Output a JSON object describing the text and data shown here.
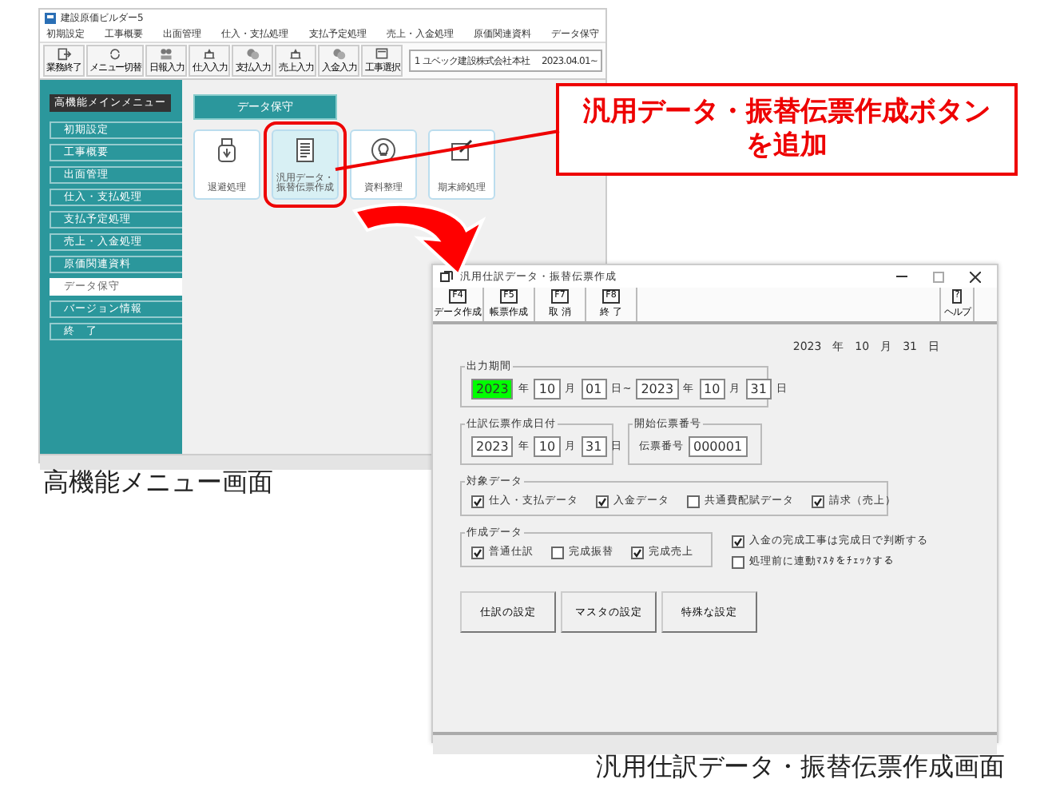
{
  "menu_window": {
    "title": "建設原価ビルダー5",
    "menu_bar": [
      "初期設定",
      "工事概要",
      "出面管理",
      "仕入・支払処理",
      "支払予定処理",
      "売上・入金処理",
      "原価関連資料",
      "データ保守"
    ],
    "toolbar": [
      "業務終了",
      "メニュー切替",
      "日報入力",
      "仕入入力",
      "支払入力",
      "売上入力",
      "入金入力",
      "工事選択"
    ],
    "company": "1 ユベック建設株式会社本社",
    "date": "2023.04.01~",
    "sidebar": {
      "header": "高機能メインメニュー",
      "items": [
        {
          "label": "初期設定",
          "selected": false
        },
        {
          "label": "工事概要",
          "selected": false
        },
        {
          "label": "出面管理",
          "selected": false
        },
        {
          "label": "仕入・支払処理",
          "selected": false
        },
        {
          "label": "支払予定処理",
          "selected": false
        },
        {
          "label": "売上・入金処理",
          "selected": false
        },
        {
          "label": "原価関連資料",
          "selected": false
        },
        {
          "label": "データ保守",
          "selected": true
        },
        {
          "label": "バージョン情報",
          "selected": false
        },
        {
          "label": "終　了",
          "selected": false
        }
      ]
    },
    "section_title": "データ保守",
    "tiles": [
      {
        "kind": "usb",
        "label": "退避処理",
        "highlighted": false
      },
      {
        "kind": "document",
        "label": "汎用データ・振替伝票作成",
        "highlighted": true
      },
      {
        "kind": "bulb",
        "label": "資料整理",
        "highlighted": false
      },
      {
        "kind": "edit",
        "label": "期末締処理",
        "highlighted": false
      }
    ]
  },
  "callout": {
    "text": "汎用データ・振替伝票作成ボタンを追加"
  },
  "form_window": {
    "title": "汎用仕訳データ・振替伝票作成",
    "toolbar": [
      {
        "key": "F4",
        "label": "データ作成"
      },
      {
        "key": "F5",
        "label": "帳票作成"
      },
      {
        "key": "F7",
        "label": "取 消"
      },
      {
        "key": "F8",
        "label": "終 了"
      }
    ],
    "help": {
      "key": "?",
      "label": "ヘルプ"
    },
    "date": "2023　年　10　月　31　日",
    "groups": [
      {
        "title": "出力期間",
        "parts": [
          {
            "kind": "field",
            "value": "2023",
            "highlighted": true
          },
          {
            "kind": "unit",
            "text": "年"
          },
          {
            "kind": "field",
            "value": "10",
            "highlighted": false
          },
          {
            "kind": "unit",
            "text": "月"
          },
          {
            "kind": "field",
            "value": "01",
            "highlighted": false
          },
          {
            "kind": "unit",
            "text": "日~"
          },
          {
            "kind": "field",
            "value": "2023",
            "highlighted": false
          },
          {
            "kind": "unit",
            "text": "年"
          },
          {
            "kind": "field",
            "value": "10",
            "highlighted": false
          },
          {
            "kind": "unit",
            "text": "月"
          },
          {
            "kind": "field",
            "value": "31",
            "highlighted": false
          },
          {
            "kind": "unit",
            "text": "日"
          }
        ]
      },
      {
        "title": "仕訳伝票作成日付",
        "parts": [
          {
            "kind": "field",
            "value": "2023",
            "highlighted": false
          },
          {
            "kind": "unit",
            "text": "年"
          },
          {
            "kind": "field",
            "value": "10",
            "highlighted": false
          },
          {
            "kind": "unit",
            "text": "月"
          },
          {
            "kind": "field",
            "value": "31",
            "highlighted": false
          },
          {
            "kind": "unit",
            "text": "日"
          }
        ]
      },
      {
        "title": "開始伝票番号",
        "parts": [
          {
            "kind": "unit",
            "text": "伝票番号"
          },
          {
            "kind": "field",
            "value": "000001",
            "highlighted": false
          }
        ]
      }
    ],
    "target_data": {
      "title": "対象データ",
      "items": [
        {
          "label": "仕入・支払データ",
          "checked": true
        },
        {
          "label": "入金データ",
          "checked": true
        },
        {
          "label": "共通費配賦データ",
          "checked": false
        },
        {
          "label": "請求（売上）",
          "checked": true
        }
      ]
    },
    "creation_data": {
      "title": "作成データ",
      "items": [
        {
          "label": "普通仕訳",
          "checked": true
        },
        {
          "label": "完成振替",
          "checked": false
        },
        {
          "label": "完成売上",
          "checked": true
        }
      ]
    },
    "options": [
      {
        "label": "入金の完成工事は完成日で判断する",
        "checked": true
      },
      {
        "label": "処理前に連動ﾏｽﾀをﾁｪｯｸする",
        "checked": false
      }
    ],
    "buttons": [
      "仕訳の設定",
      "マスタの設定",
      "特殊な設定"
    ]
  },
  "captions": [
    "高機能メニュー画面",
    "汎用仕訳データ・振替伝票作成画面"
  ]
}
